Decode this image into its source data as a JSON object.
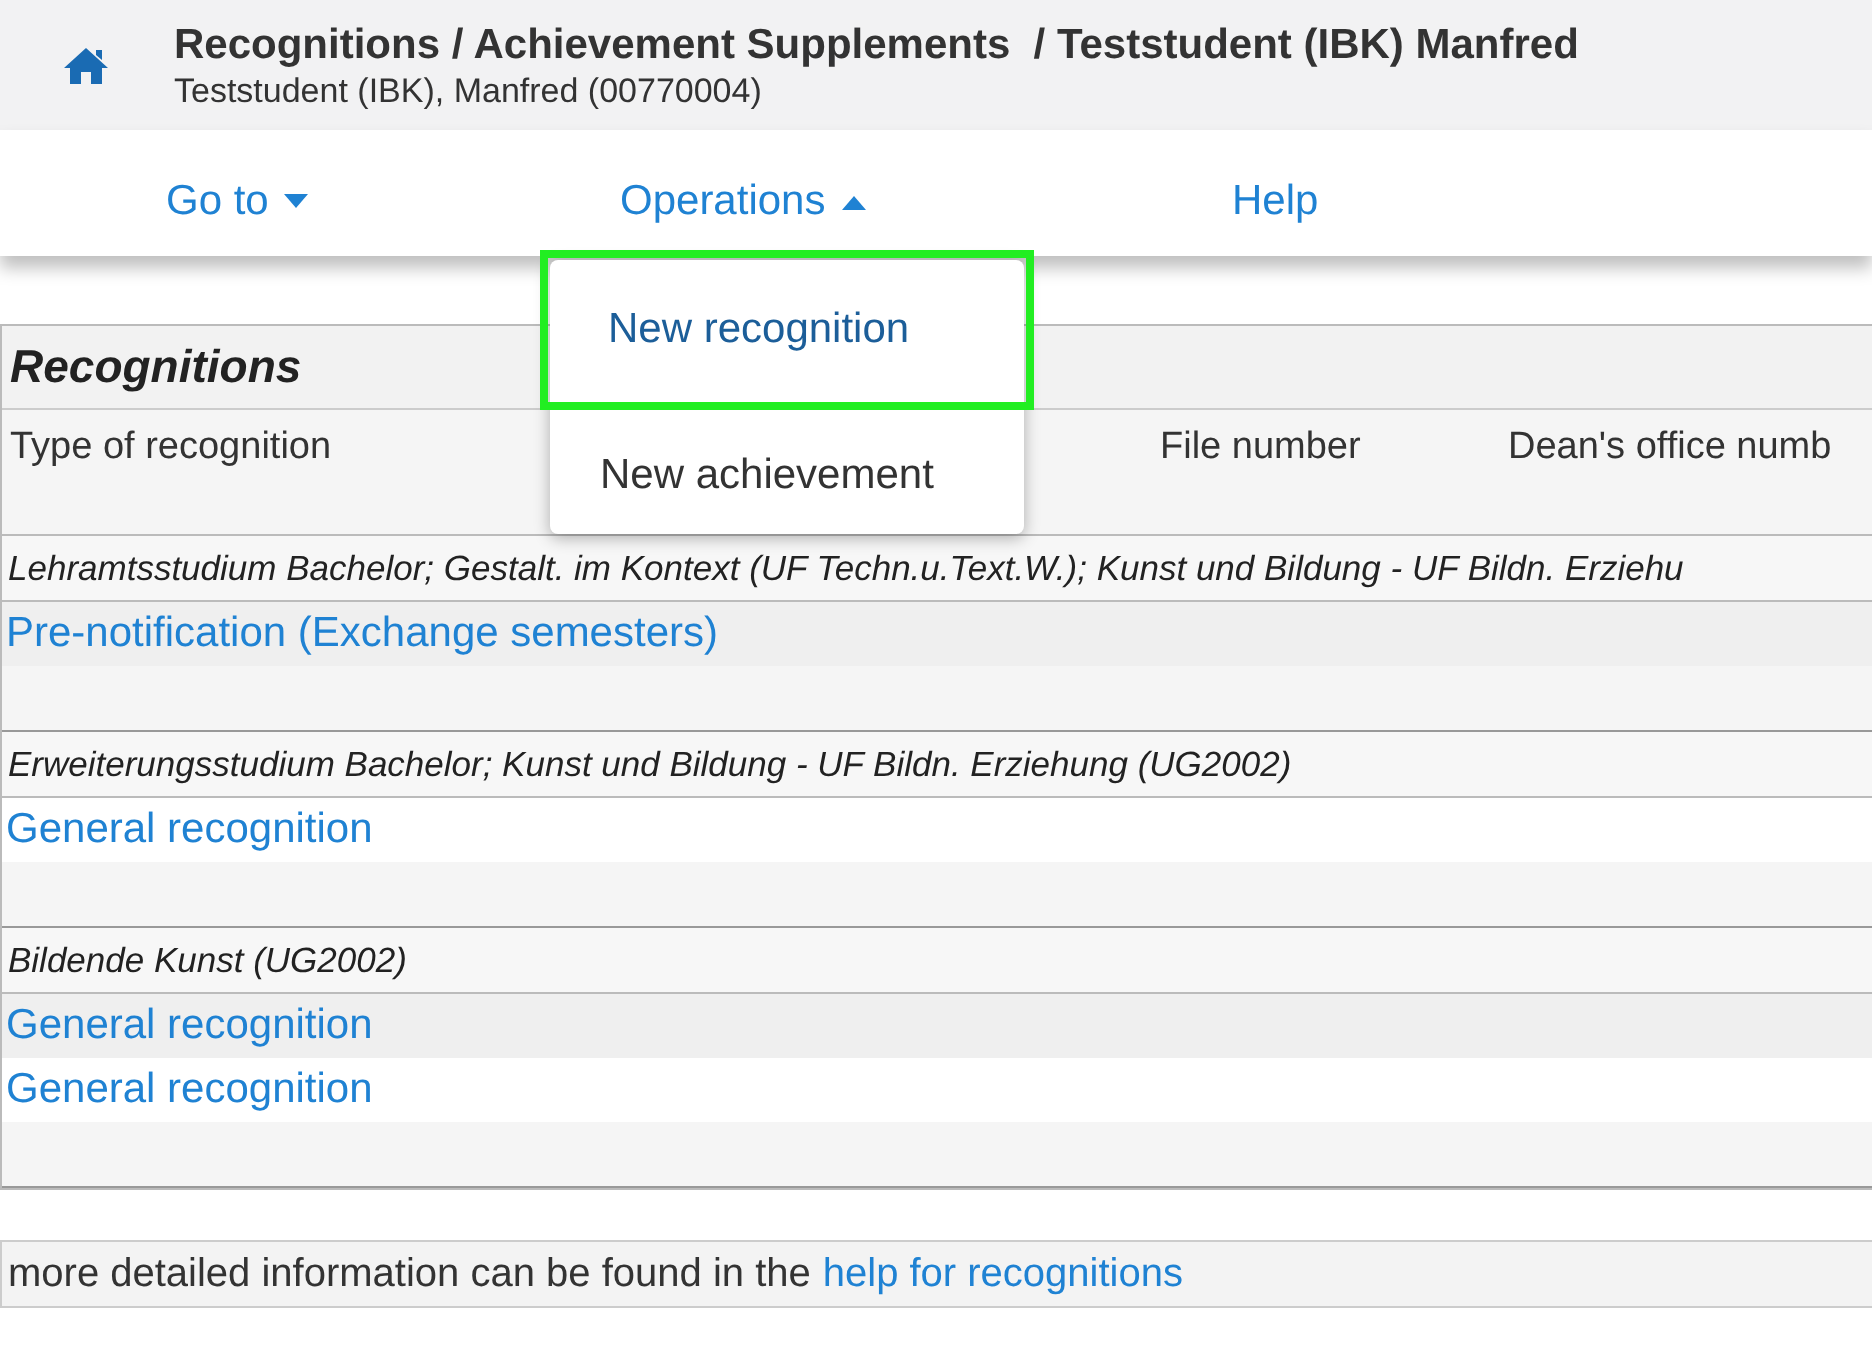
{
  "header": {
    "title": "Recognitions / Achievement Supplements  / Teststudent (IBK) Manfred",
    "subtitle": "Teststudent (IBK), Manfred (00770004)"
  },
  "nav": [
    {
      "label": "Go to",
      "expanded": false
    },
    {
      "label": "Operations",
      "expanded": true
    },
    {
      "label": "Help"
    }
  ],
  "menu": [
    {
      "label": "New recognition",
      "highlighted": true
    },
    {
      "label": "New achievement",
      "highlighted": false
    }
  ],
  "table": {
    "title": "Recognitions",
    "columns": [
      "Type of recognition",
      "File number",
      "Dean's office numb"
    ],
    "groups": [
      {
        "heading": "Lehramtsstudium Bachelor; Gestalt. im Kontext (UF Techn.u.Text.W.); Kunst und Bildung - UF Bildn. Erziehu",
        "items": [
          "Pre-notification (Exchange semesters)"
        ]
      },
      {
        "heading": "Erweiterungsstudium Bachelor; Kunst und Bildung - UF Bildn. Erziehung (UG2002)",
        "items": [
          "General recognition"
        ]
      },
      {
        "heading": "Bildende Kunst (UG2002)",
        "items": [
          "General recognition",
          "General recognition"
        ]
      }
    ]
  },
  "footer": {
    "text": "more detailed information can be found in the",
    "link": "help for recognitions"
  }
}
